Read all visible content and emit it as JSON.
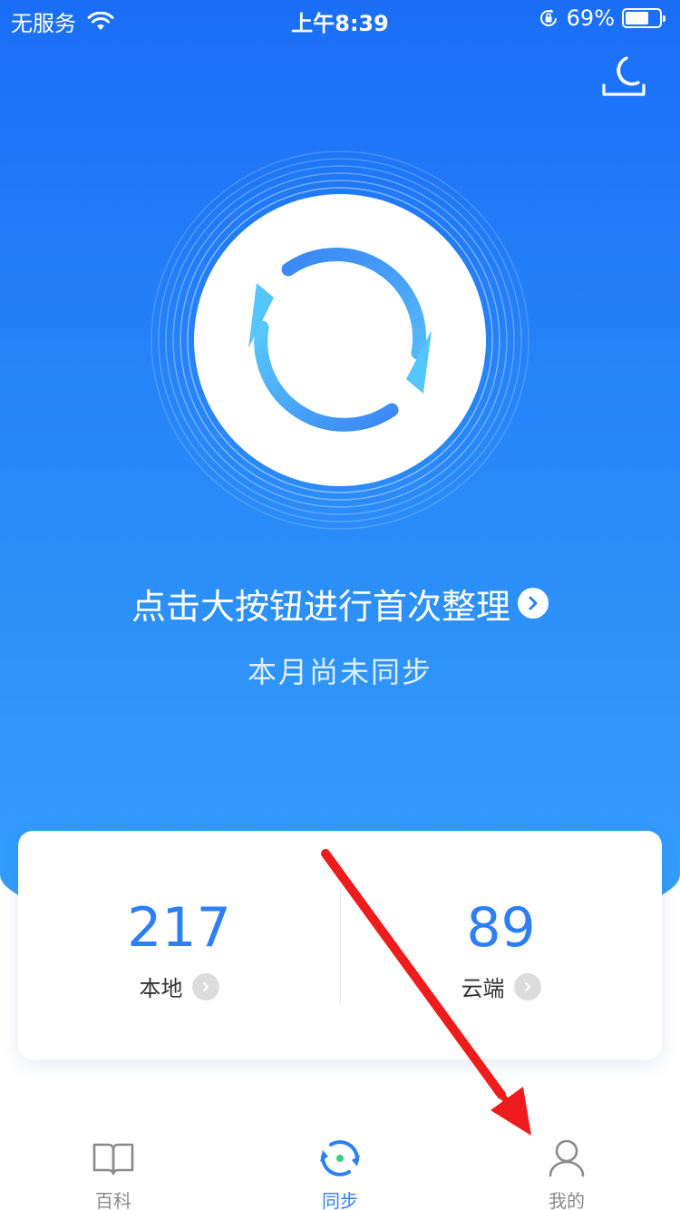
{
  "status_bar": {
    "carrier": "无服务",
    "time": "上午8:39",
    "battery_percent_label": "69%",
    "battery_level": 0.69,
    "icons": [
      "wifi-icon",
      "orientation-lock-icon",
      "battery-icon"
    ]
  },
  "header": {
    "night_mode_icon": "moon-icon"
  },
  "sync": {
    "button_icon": "sync-icon",
    "headline": "点击大按钮进行首次整理",
    "headline_icon": "chevron-right-icon",
    "status": "本月尚未同步"
  },
  "stats": {
    "local": {
      "value": "217",
      "label": "本地"
    },
    "cloud": {
      "value": "89",
      "label": "云端"
    }
  },
  "tabbar": {
    "tabs": [
      {
        "label": "百科",
        "icon": "book-icon",
        "active": false
      },
      {
        "label": "同步",
        "icon": "sync-tab-icon",
        "active": true
      },
      {
        "label": "我的",
        "icon": "user-icon",
        "active": false
      }
    ]
  },
  "colors": {
    "primary": "#2d7ff6",
    "hero_top": "#1a6ef8",
    "hero_bottom": "#33a0fb",
    "annotation_arrow": "#ee1c1c",
    "inactive_tab": "#8a8a8a"
  }
}
